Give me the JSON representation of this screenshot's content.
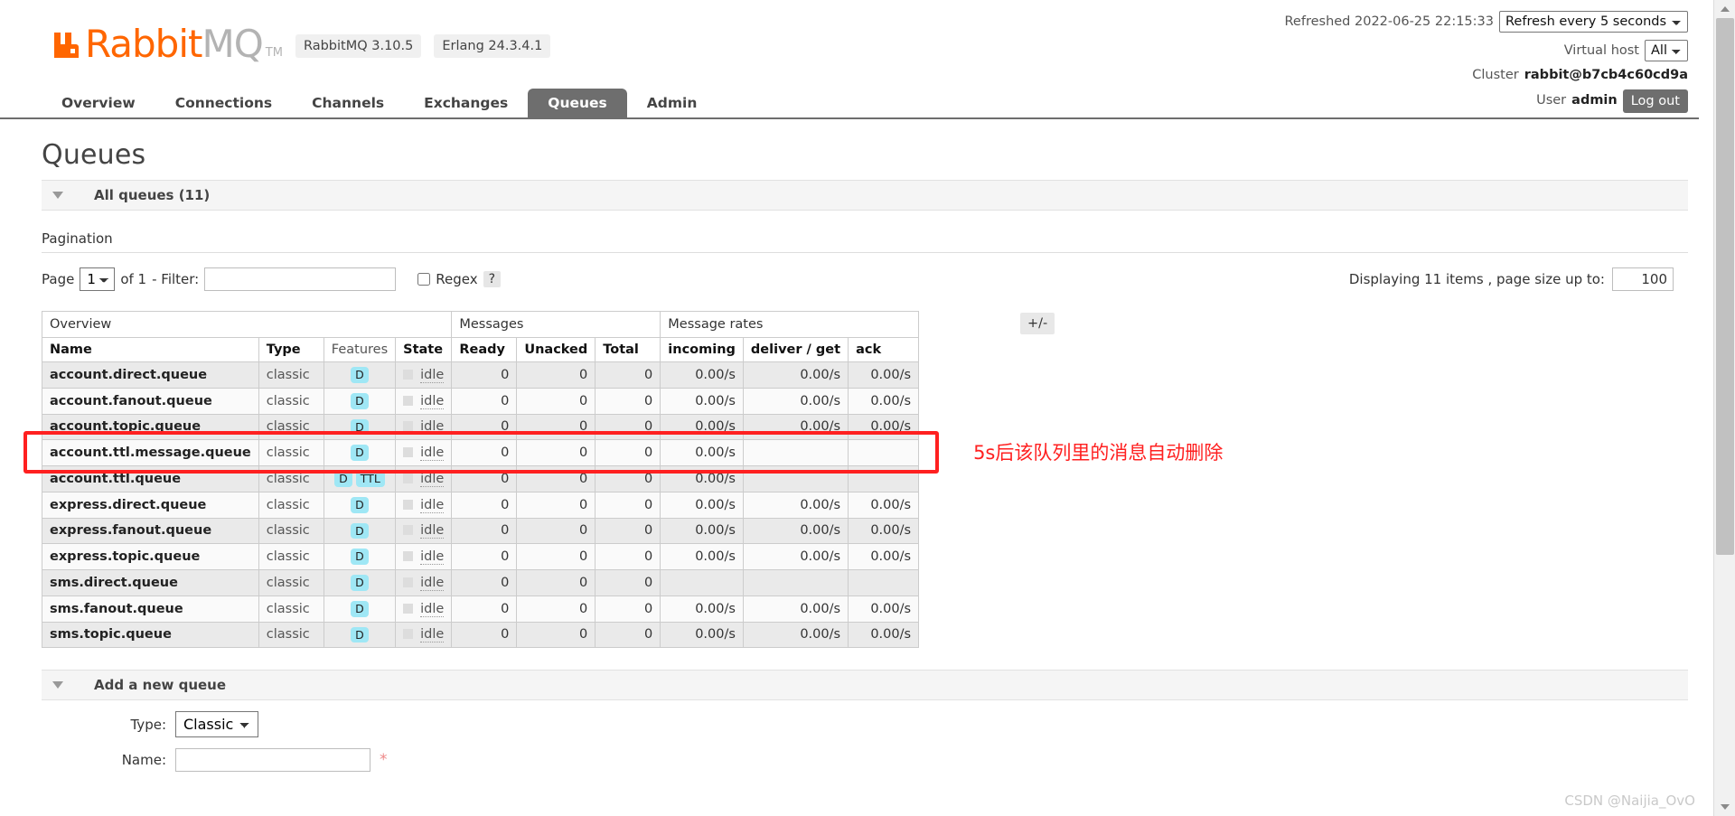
{
  "header": {
    "logo": {
      "rabbit": "Rabbit",
      "mq": "MQ",
      "tm": "TM"
    },
    "version_badge": "RabbitMQ 3.10.5",
    "erlang_badge": "Erlang 24.3.4.1",
    "refreshed_label": "Refreshed 2022-06-25 22:15:33",
    "refresh_select": "Refresh every 5 seconds",
    "vhost_label": "Virtual host",
    "vhost_select": "All",
    "cluster_label": "Cluster",
    "cluster_name": "rabbit@b7cb4c60cd9a",
    "user_label": "User",
    "user_name": "admin",
    "logout_label": "Log out"
  },
  "nav": {
    "tabs": [
      {
        "label": "Overview",
        "active": false
      },
      {
        "label": "Connections",
        "active": false
      },
      {
        "label": "Channels",
        "active": false
      },
      {
        "label": "Exchanges",
        "active": false
      },
      {
        "label": "Queues",
        "active": true
      },
      {
        "label": "Admin",
        "active": false
      }
    ]
  },
  "main": {
    "page_title": "Queues",
    "all_queues_label": "All queues (11)",
    "pagination_label": "Pagination",
    "page_label": "Page",
    "page_value": "1",
    "of_label": "of 1",
    "filter_label": "- Filter:",
    "filter_value": "",
    "filter_placeholder": "",
    "regex_label": "Regex",
    "help_label": "?",
    "displaying_label": "Displaying 11 items , page size up to:",
    "page_size_value": "100",
    "plus_minus_label": "+/-"
  },
  "table": {
    "group_headers": [
      {
        "label": "Overview",
        "span": 4
      },
      {
        "label": "Messages",
        "span": 3
      },
      {
        "label": "Message rates",
        "span": 3
      }
    ],
    "columns": [
      {
        "label": "Name",
        "align": "left",
        "bold": true
      },
      {
        "label": "Type",
        "align": "left",
        "bold": true
      },
      {
        "label": "Features",
        "align": "left",
        "bold": false
      },
      {
        "label": "State",
        "align": "left",
        "bold": true
      },
      {
        "label": "Ready",
        "align": "left",
        "bold": true
      },
      {
        "label": "Unacked",
        "align": "left",
        "bold": true
      },
      {
        "label": "Total",
        "align": "left",
        "bold": true
      },
      {
        "label": "incoming",
        "align": "left",
        "bold": true
      },
      {
        "label": "deliver / get",
        "align": "left",
        "bold": true
      },
      {
        "label": "ack",
        "align": "left",
        "bold": true
      }
    ],
    "rows": [
      {
        "name": "account.direct.queue",
        "type": "classic",
        "features": [
          "D"
        ],
        "state": "idle",
        "ready": "0",
        "unacked": "0",
        "total": "0",
        "incoming": "0.00/s",
        "deliver_get": "0.00/s",
        "ack": "0.00/s"
      },
      {
        "name": "account.fanout.queue",
        "type": "classic",
        "features": [
          "D"
        ],
        "state": "idle",
        "ready": "0",
        "unacked": "0",
        "total": "0",
        "incoming": "0.00/s",
        "deliver_get": "0.00/s",
        "ack": "0.00/s"
      },
      {
        "name": "account.topic.queue",
        "type": "classic",
        "features": [
          "D"
        ],
        "state": "idle",
        "ready": "0",
        "unacked": "0",
        "total": "0",
        "incoming": "0.00/s",
        "deliver_get": "0.00/s",
        "ack": "0.00/s"
      },
      {
        "name": "account.ttl.message.queue",
        "type": "classic",
        "features": [
          "D"
        ],
        "state": "idle",
        "ready": "0",
        "unacked": "0",
        "total": "0",
        "incoming": "0.00/s",
        "deliver_get": "",
        "ack": ""
      },
      {
        "name": "account.ttl.queue",
        "type": "classic",
        "features": [
          "D",
          "TTL"
        ],
        "state": "idle",
        "ready": "0",
        "unacked": "0",
        "total": "0",
        "incoming": "0.00/s",
        "deliver_get": "",
        "ack": ""
      },
      {
        "name": "express.direct.queue",
        "type": "classic",
        "features": [
          "D"
        ],
        "state": "idle",
        "ready": "0",
        "unacked": "0",
        "total": "0",
        "incoming": "0.00/s",
        "deliver_get": "0.00/s",
        "ack": "0.00/s"
      },
      {
        "name": "express.fanout.queue",
        "type": "classic",
        "features": [
          "D"
        ],
        "state": "idle",
        "ready": "0",
        "unacked": "0",
        "total": "0",
        "incoming": "0.00/s",
        "deliver_get": "0.00/s",
        "ack": "0.00/s"
      },
      {
        "name": "express.topic.queue",
        "type": "classic",
        "features": [
          "D"
        ],
        "state": "idle",
        "ready": "0",
        "unacked": "0",
        "total": "0",
        "incoming": "0.00/s",
        "deliver_get": "0.00/s",
        "ack": "0.00/s"
      },
      {
        "name": "sms.direct.queue",
        "type": "classic",
        "features": [
          "D"
        ],
        "state": "idle",
        "ready": "0",
        "unacked": "0",
        "total": "0",
        "incoming": "",
        "deliver_get": "",
        "ack": ""
      },
      {
        "name": "sms.fanout.queue",
        "type": "classic",
        "features": [
          "D"
        ],
        "state": "idle",
        "ready": "0",
        "unacked": "0",
        "total": "0",
        "incoming": "0.00/s",
        "deliver_get": "0.00/s",
        "ack": "0.00/s"
      },
      {
        "name": "sms.topic.queue",
        "type": "classic",
        "features": [
          "D"
        ],
        "state": "idle",
        "ready": "0",
        "unacked": "0",
        "total": "0",
        "incoming": "0.00/s",
        "deliver_get": "0.00/s",
        "ack": "0.00/s"
      }
    ]
  },
  "annotation": {
    "text": "5s后该队列里的消息自动删除",
    "color": "#ff2020",
    "target_row": "account.ttl.message.queue"
  },
  "add_queue": {
    "section_label": "Add a new queue",
    "type_label": "Type:",
    "type_value": "Classic",
    "name_label": "Name:",
    "name_value": "",
    "required_mark": "*"
  },
  "watermark": "CSDN @Naijia_OvO"
}
